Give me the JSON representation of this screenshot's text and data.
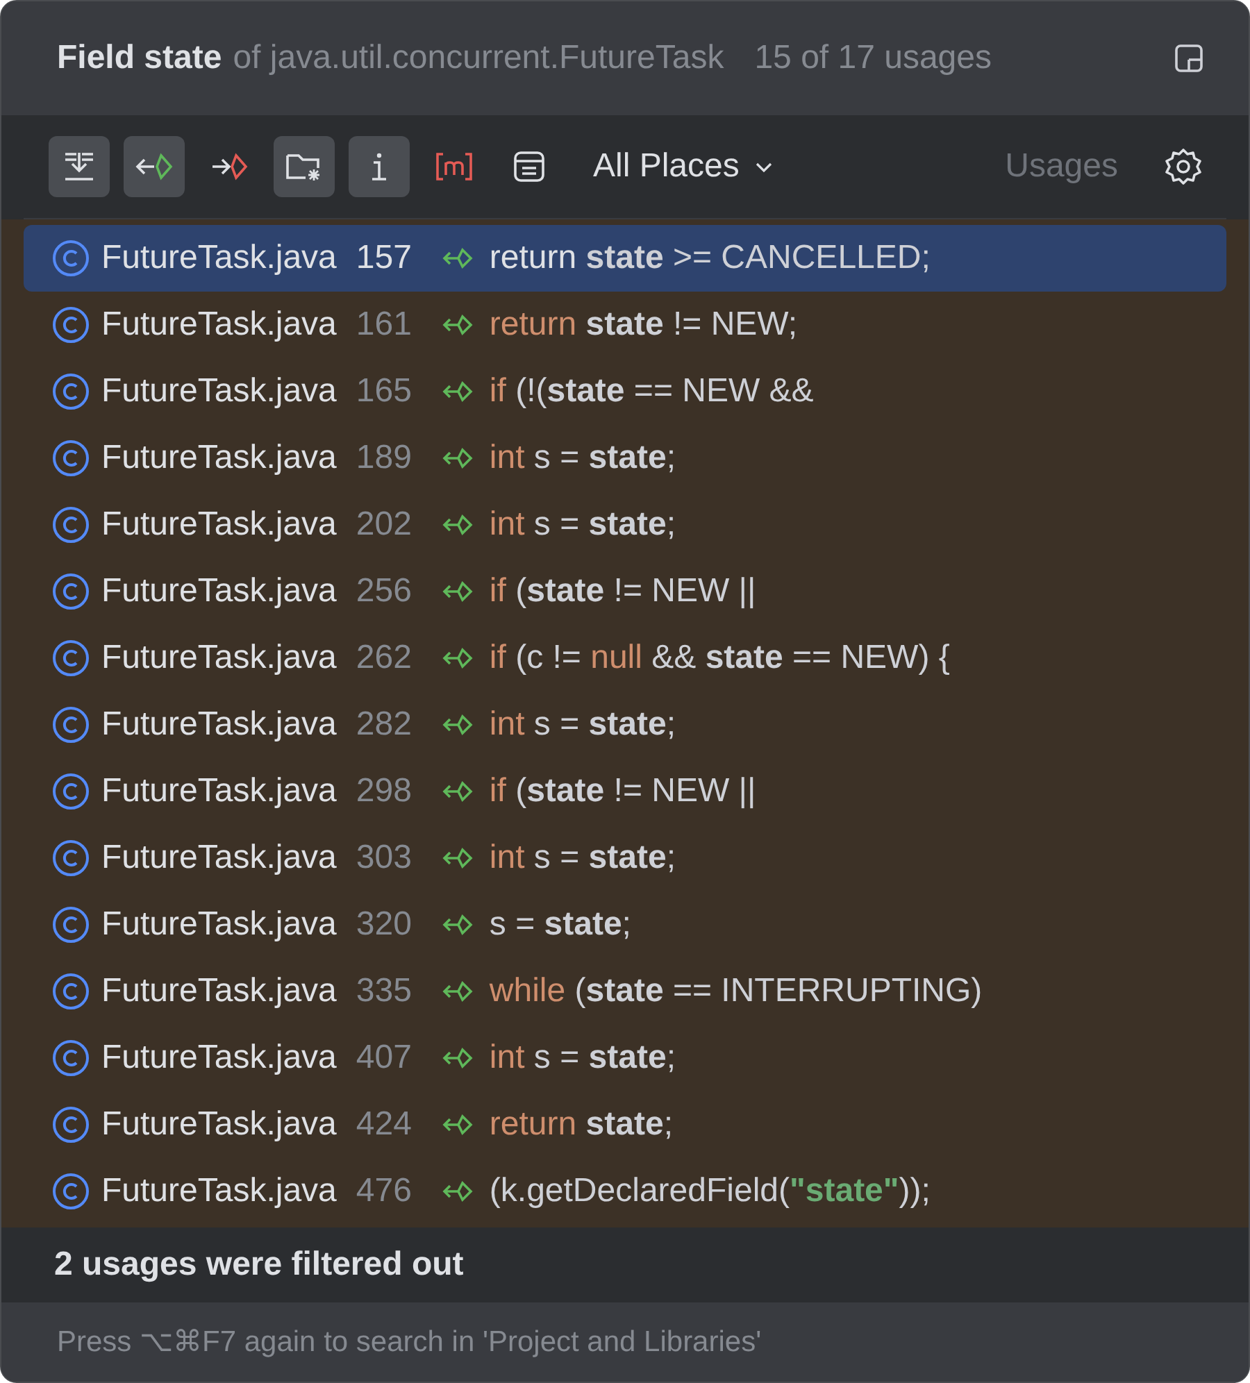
{
  "header": {
    "title": "Field state",
    "subtitle": "of java.util.concurrent.FutureTask",
    "count": "15 of 17 usages"
  },
  "toolbar": {
    "buttons": [
      {
        "kind": "merge",
        "selected": true
      },
      {
        "kind": "read",
        "selected": true
      },
      {
        "kind": "write",
        "selected": false
      },
      {
        "kind": "folder",
        "selected": true
      },
      {
        "kind": "info",
        "selected": true
      },
      {
        "kind": "method",
        "selected": false
      },
      {
        "kind": "preview",
        "selected": false
      }
    ],
    "scope": "All Places",
    "filter": "Usages"
  },
  "rows": [
    {
      "file": "FutureTask.java",
      "line": "157",
      "selected": true,
      "code": [
        {
          "kind": "keyword",
          "text": "return "
        },
        {
          "kind": "field",
          "text": "state"
        },
        {
          "kind": "plain",
          "text": " >= CANCELLED;"
        }
      ]
    },
    {
      "file": "FutureTask.java",
      "line": "161",
      "selected": false,
      "code": [
        {
          "kind": "keyword",
          "text": "return "
        },
        {
          "kind": "field",
          "text": "state"
        },
        {
          "kind": "plain",
          "text": " != NEW;"
        }
      ]
    },
    {
      "file": "FutureTask.java",
      "line": "165",
      "selected": false,
      "code": [
        {
          "kind": "keyword",
          "text": "if "
        },
        {
          "kind": "plain",
          "text": "(!("
        },
        {
          "kind": "field",
          "text": "state"
        },
        {
          "kind": "plain",
          "text": " == NEW &&"
        }
      ]
    },
    {
      "file": "FutureTask.java",
      "line": "189",
      "selected": false,
      "code": [
        {
          "kind": "keyword",
          "text": "int "
        },
        {
          "kind": "plain",
          "text": "s = "
        },
        {
          "kind": "field",
          "text": "state"
        },
        {
          "kind": "plain",
          "text": ";"
        }
      ]
    },
    {
      "file": "FutureTask.java",
      "line": "202",
      "selected": false,
      "code": [
        {
          "kind": "keyword",
          "text": "int "
        },
        {
          "kind": "plain",
          "text": "s = "
        },
        {
          "kind": "field",
          "text": "state"
        },
        {
          "kind": "plain",
          "text": ";"
        }
      ]
    },
    {
      "file": "FutureTask.java",
      "line": "256",
      "selected": false,
      "code": [
        {
          "kind": "keyword",
          "text": "if "
        },
        {
          "kind": "plain",
          "text": "("
        },
        {
          "kind": "field",
          "text": "state"
        },
        {
          "kind": "plain",
          "text": " != NEW ||"
        }
      ]
    },
    {
      "file": "FutureTask.java",
      "line": "262",
      "selected": false,
      "code": [
        {
          "kind": "keyword",
          "text": "if "
        },
        {
          "kind": "plain",
          "text": "(c != "
        },
        {
          "kind": "keyword",
          "text": "null"
        },
        {
          "kind": "plain",
          "text": " && "
        },
        {
          "kind": "field",
          "text": "state"
        },
        {
          "kind": "plain",
          "text": " == NEW) {"
        }
      ]
    },
    {
      "file": "FutureTask.java",
      "line": "282",
      "selected": false,
      "code": [
        {
          "kind": "keyword",
          "text": "int "
        },
        {
          "kind": "plain",
          "text": "s = "
        },
        {
          "kind": "field",
          "text": "state"
        },
        {
          "kind": "plain",
          "text": ";"
        }
      ]
    },
    {
      "file": "FutureTask.java",
      "line": "298",
      "selected": false,
      "code": [
        {
          "kind": "keyword",
          "text": "if "
        },
        {
          "kind": "plain",
          "text": "("
        },
        {
          "kind": "field",
          "text": "state"
        },
        {
          "kind": "plain",
          "text": " != NEW ||"
        }
      ]
    },
    {
      "file": "FutureTask.java",
      "line": "303",
      "selected": false,
      "code": [
        {
          "kind": "keyword",
          "text": "int "
        },
        {
          "kind": "plain",
          "text": "s = "
        },
        {
          "kind": "field",
          "text": "state"
        },
        {
          "kind": "plain",
          "text": ";"
        }
      ]
    },
    {
      "file": "FutureTask.java",
      "line": "320",
      "selected": false,
      "code": [
        {
          "kind": "plain",
          "text": "s = "
        },
        {
          "kind": "field",
          "text": "state"
        },
        {
          "kind": "plain",
          "text": ";"
        }
      ]
    },
    {
      "file": "FutureTask.java",
      "line": "335",
      "selected": false,
      "code": [
        {
          "kind": "keyword",
          "text": "while "
        },
        {
          "kind": "plain",
          "text": "("
        },
        {
          "kind": "field",
          "text": "state"
        },
        {
          "kind": "plain",
          "text": " == INTERRUPTING)"
        }
      ]
    },
    {
      "file": "FutureTask.java",
      "line": "407",
      "selected": false,
      "code": [
        {
          "kind": "keyword",
          "text": "int "
        },
        {
          "kind": "plain",
          "text": "s = "
        },
        {
          "kind": "field",
          "text": "state"
        },
        {
          "kind": "plain",
          "text": ";"
        }
      ]
    },
    {
      "file": "FutureTask.java",
      "line": "424",
      "selected": false,
      "code": [
        {
          "kind": "keyword",
          "text": "return "
        },
        {
          "kind": "field",
          "text": "state"
        },
        {
          "kind": "plain",
          "text": ";"
        }
      ]
    },
    {
      "file": "FutureTask.java",
      "line": "476",
      "selected": false,
      "code": [
        {
          "kind": "plain",
          "text": "(k.getDeclaredField("
        },
        {
          "kind": "string",
          "text": "\"state\""
        },
        {
          "kind": "plain",
          "text": "));"
        }
      ]
    }
  ],
  "filtered_note": "2 usages were filtered out",
  "hint": "Press ⌥⌘F7 again to search in 'Project and Libraries'"
}
